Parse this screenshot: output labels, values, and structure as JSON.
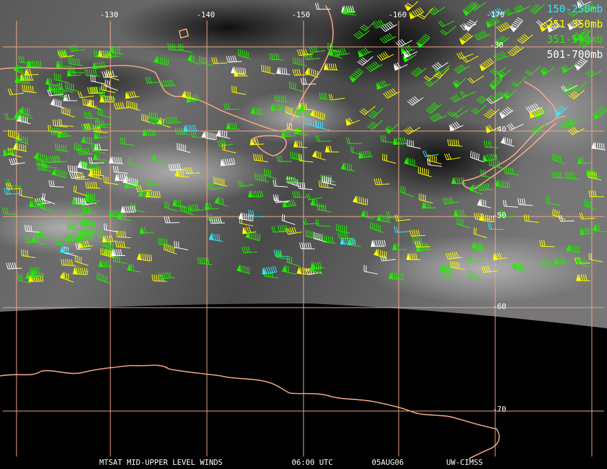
{
  "image": {
    "lon_labels": [
      "-130",
      "-140",
      "-150",
      "-160",
      "-170"
    ],
    "lat_labels": [
      "-30",
      "-40",
      "-50",
      "-60",
      "-70"
    ]
  },
  "legend": [
    {
      "label": "150-250mb",
      "color": "#33e6ff"
    },
    {
      "label": "251-350mb",
      "color": "#ffff00"
    },
    {
      "label": "351-500mb",
      "color": "#22ee00"
    },
    {
      "label": "501-700mb",
      "color": "#ffffff"
    }
  ],
  "caption": {
    "product": "MTSAT MID-UPPER LEVEL WINDS",
    "time": "06:00 UTC",
    "date": "05AUG06",
    "source": "UW-CIMSS"
  },
  "colors": {
    "grid": "#f2a888",
    "coast": "#f2a888",
    "background": "#000000"
  }
}
